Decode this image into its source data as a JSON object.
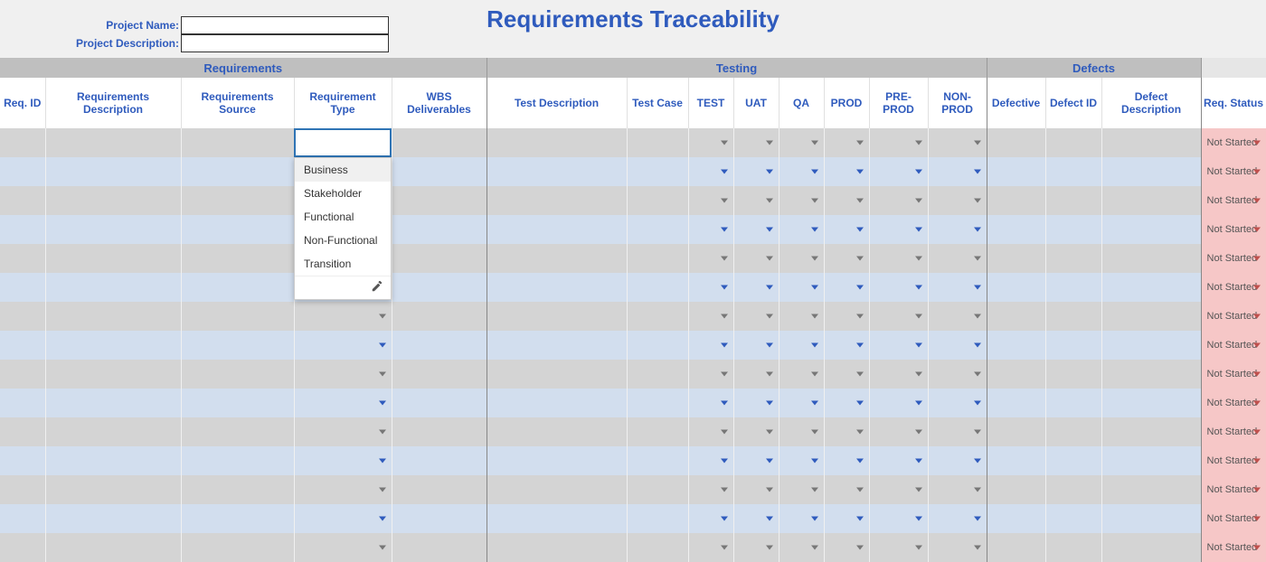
{
  "header": {
    "title": "Requirements Traceability",
    "project_name_label": "Project Name:",
    "project_desc_label": "Project Description:",
    "project_name_value": "",
    "project_desc_value": ""
  },
  "groups": {
    "requirements": "Requirements",
    "testing": "Testing",
    "defects": "Defects"
  },
  "columns": {
    "req_id": "Req. ID",
    "req_desc": "Requirements Description",
    "req_source": "Requirements Source",
    "req_type": "Requirement Type",
    "wbs": "WBS Deliverables",
    "test_desc": "Test Description",
    "test_case": "Test Case",
    "test": "TEST",
    "uat": "UAT",
    "qa": "QA",
    "prod": "PROD",
    "pre_prod": "PRE-PROD",
    "non_prod": "NON-PROD",
    "defective": "Defective",
    "defect_id": "Defect ID",
    "defect_desc": "Defect Description",
    "status": "Req. Status"
  },
  "dropdown": {
    "options": [
      "Business",
      "Stakeholder",
      "Functional",
      "Non-Functional",
      "Transition"
    ]
  },
  "status_default": "Not Started",
  "row_count": 15
}
